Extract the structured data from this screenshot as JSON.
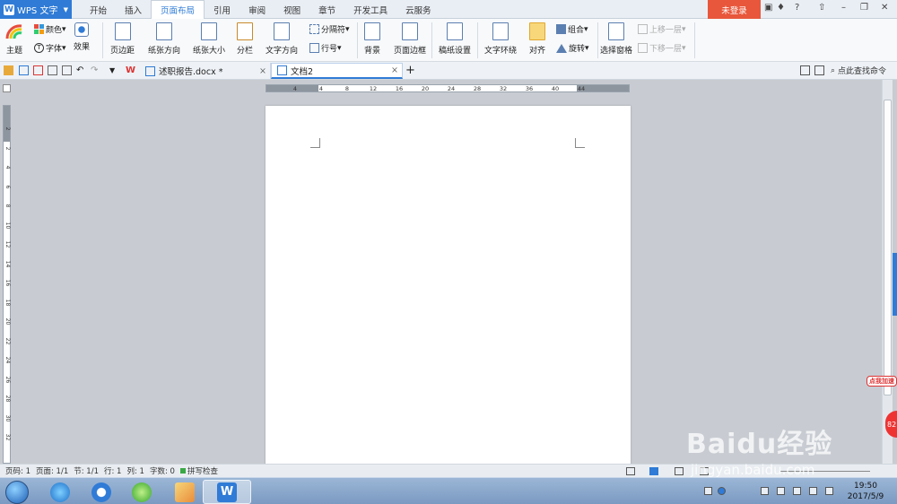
{
  "app": {
    "name": "WPS 文字"
  },
  "menu": {
    "tabs": [
      "开始",
      "插入",
      "页面布局",
      "引用",
      "审阅",
      "视图",
      "章节",
      "开发工具",
      "云服务"
    ],
    "active_index": 2
  },
  "login_label": "未登录",
  "window_controls": [
    "?"
  ],
  "ribbon": {
    "theme": "主题",
    "color": "颜色",
    "font": "字体",
    "effect": "效果",
    "margins": "页边距",
    "orientation": "纸张方向",
    "size": "纸张大小",
    "columns": "分栏",
    "text_direction": "文字方向",
    "breaks": "分隔符",
    "line_numbers": "行号",
    "background": "背景",
    "page_border": "页面边框",
    "manuscript": "稿纸设置",
    "text_wrap": "文字环绕",
    "align": "对齐",
    "group": "组合",
    "rotate": "旋转",
    "selection_pane": "选择窗格",
    "bring_forward": "上移一层",
    "send_backward": "下移一层"
  },
  "tabs": {
    "doc1": "述职报告.docx *",
    "doc2": "文档2",
    "close_symbol": "×",
    "add_symbol": "+"
  },
  "find_command": "点此查找命令",
  "ruler": {
    "horizontal": [
      "4",
      "4",
      "8",
      "12",
      "16",
      "20",
      "24",
      "28",
      "32",
      "36",
      "40",
      "44"
    ],
    "vertical": [
      "2",
      "2",
      "4",
      "6",
      "8",
      "10",
      "12",
      "14",
      "16",
      "18",
      "20",
      "22",
      "24",
      "26",
      "28",
      "30",
      "32"
    ]
  },
  "status": {
    "page_num": "页码: 1",
    "pages": "页面: 1/1",
    "section": "节: 1/1",
    "row": "行: 1",
    "col": "列: 1",
    "words": "字数: 0",
    "spell": "拼写检查"
  },
  "taskbar": {
    "time": "19:50",
    "date": "2017/5/9"
  },
  "watermark": {
    "main": "Baidu经验",
    "sub": "jingyan.baidu.com",
    "speedup": "点我加速",
    "badge": "82"
  },
  "colors": {
    "accent": "#2f7bd6",
    "login": "#e8573b"
  }
}
